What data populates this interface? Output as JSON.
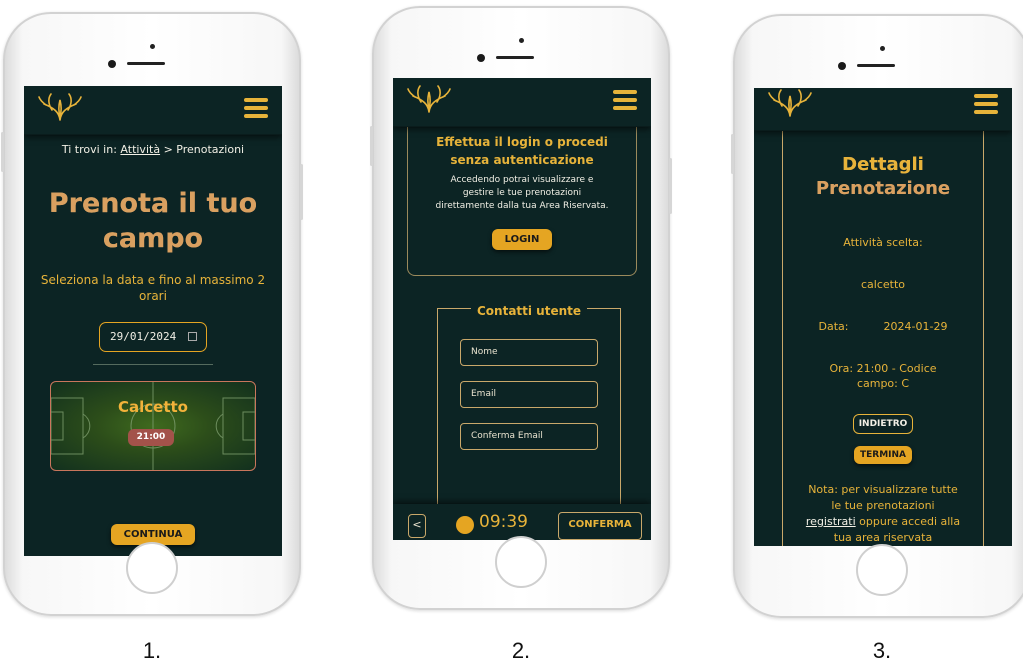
{
  "captions": [
    "1.",
    "2.",
    "3."
  ],
  "colors": {
    "background": "#0c2424",
    "gold": "#e7b33a",
    "button": "#e5a522",
    "slot": "#a3524a"
  },
  "screen1": {
    "breadcrumb_prefix": "Ti trovi in:",
    "breadcrumb_link": "Attività",
    "breadcrumb_sep": ">",
    "breadcrumb_current": "Prenotazioni",
    "title_line1": "Prenota il tuo",
    "title_line2": "campo",
    "subtitle": "Seleziona la data e fino al massimo 2 orari",
    "date_value": "29/01/2024",
    "field_name": "Calcetto",
    "slot_time": "21:00",
    "continue_label": "CONTINUA"
  },
  "screen2": {
    "login_title_line1": "Effettua il login o procedi",
    "login_title_line2": "senza autenticazione",
    "login_text_line1": "Accedendo potrai visualizzare e",
    "login_text_line2": "gestire le tue prenotazioni",
    "login_text_line3": "direttamente dalla tua Area Riservata.",
    "login_label": "LOGIN",
    "contacts_legend": "Contatti utente",
    "name_placeholder": "Nome",
    "email_placeholder": "Email",
    "confirm_email_placeholder": "Conferma Email",
    "back_label": "<",
    "timer": "09:39",
    "confirm_label": "CONFERMA"
  },
  "screen3": {
    "title_line1": "Dettagli",
    "title_line2": "Prenotazione",
    "activity_label": "Attività scelta:",
    "activity_value": "calcetto",
    "date_label": "Data:",
    "date_value": "2024-01-29",
    "time_line1": "Ora: 21:00 - Codice",
    "time_line2": "campo: C",
    "back_label": "INDIETRO",
    "finish_label": "TERMINA",
    "note_line1": "Nota: per visualizzare tutte",
    "note_line2": "le tue prenotazioni",
    "note_link": "registrati",
    "note_line3_rest": "oppure accedi alla",
    "note_line4": "tua area riservata"
  }
}
